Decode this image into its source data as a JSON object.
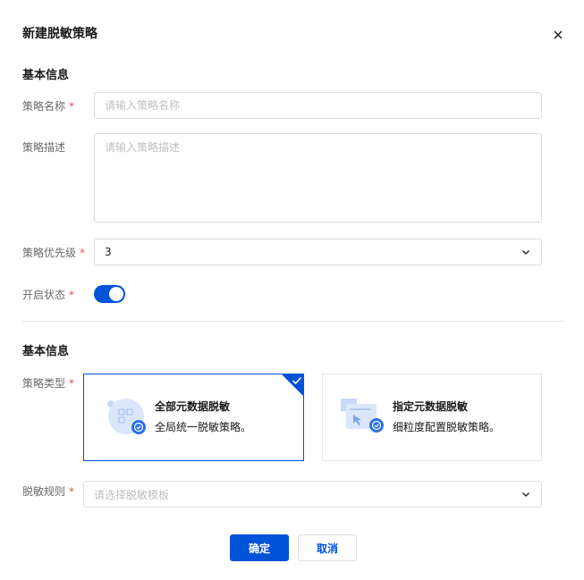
{
  "dialog": {
    "title": "新建脱敏策略",
    "close_icon": "close-icon"
  },
  "sections": {
    "basic_info_1": "基本信息",
    "basic_info_2": "基本信息"
  },
  "form": {
    "name": {
      "label": "策略名称",
      "required": "*",
      "placeholder": "请输入策略名称",
      "value": ""
    },
    "description": {
      "label": "策略描述",
      "placeholder": "请输入策略描述",
      "value": ""
    },
    "priority": {
      "label": "策略优先级",
      "required": "*",
      "value": "3"
    },
    "enabled": {
      "label": "开启状态",
      "required": "*",
      "on": true
    },
    "type": {
      "label": "策略类型",
      "required": "*",
      "options": [
        {
          "title": "全部元数据脱敏",
          "desc": "全局统一脱敏策略。",
          "selected": true,
          "icon": "full-metadata-icon"
        },
        {
          "title": "指定元数据脱敏",
          "desc": "细粒度配置脱敏策略。",
          "selected": false,
          "icon": "specified-metadata-icon"
        }
      ]
    },
    "rule": {
      "label": "脱敏规则",
      "required": "*",
      "placeholder": "请选择脱敏模板"
    }
  },
  "actions": {
    "confirm": "确定",
    "cancel": "取消"
  },
  "colors": {
    "primary": "#0052d9",
    "required": "#e34d59",
    "border": "#dcdcdc"
  }
}
